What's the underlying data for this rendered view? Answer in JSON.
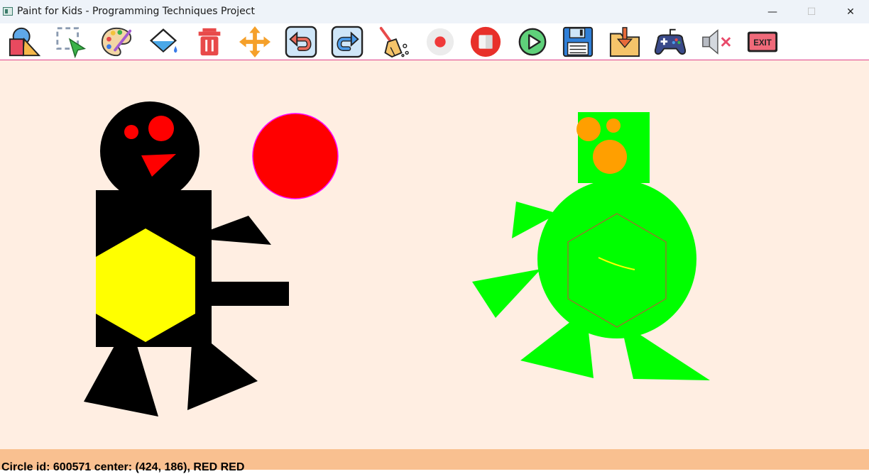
{
  "window": {
    "title": "Paint for Kids - Programming Techniques Project",
    "minimize_glyph": "—",
    "maximize_glyph": "☐",
    "close_glyph": "✕"
  },
  "toolbar": {
    "items": [
      {
        "name": "shapes-icon"
      },
      {
        "name": "select-icon"
      },
      {
        "name": "palette-icon"
      },
      {
        "name": "fill-bucket-icon"
      },
      {
        "name": "delete-icon"
      },
      {
        "name": "move-icon"
      },
      {
        "name": "undo-icon"
      },
      {
        "name": "redo-icon"
      },
      {
        "name": "clear-broom-icon"
      },
      {
        "name": "record-icon"
      },
      {
        "name": "stop-icon"
      },
      {
        "name": "play-icon"
      },
      {
        "name": "save-icon"
      },
      {
        "name": "load-icon"
      },
      {
        "name": "play-mode-gamepad-icon"
      },
      {
        "name": "mute-icon"
      },
      {
        "name": "exit-icon",
        "label": "EXIT"
      }
    ]
  },
  "colors": {
    "canvas_bg": "#ffeee2",
    "status_bg": "#f9c090",
    "black": "#000000",
    "red": "#ff0000",
    "yellow": "#ffff00",
    "green": "#00ff00",
    "orange": "#ff9f00",
    "magenta_border": "#ff00ff",
    "hex_outline": "#d04040"
  },
  "status": {
    "text": "Circle id: 600571 center: (424, 186), RED RED"
  }
}
